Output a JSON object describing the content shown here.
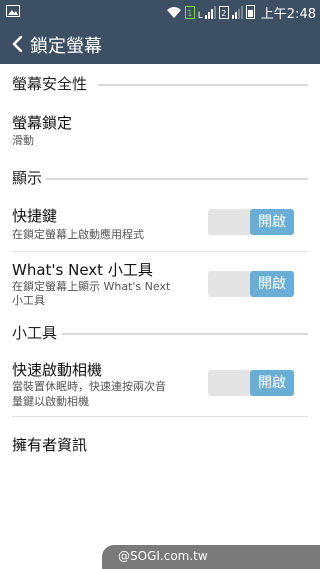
{
  "status_bar": {
    "time": "上午2:48",
    "sim1": "1",
    "sim2": "2",
    "net_type": "L",
    "icons": [
      "image-icon",
      "wifi-icon",
      "signal-icon",
      "battery-icon"
    ]
  },
  "app_bar": {
    "title": "鎖定螢幕",
    "back_icon": "chevron-left-icon"
  },
  "sections": {
    "security": {
      "header": "螢幕安全性",
      "screen_lock": {
        "title": "螢幕鎖定",
        "value": "滑動"
      }
    },
    "display": {
      "header": "顯示",
      "shortcut": {
        "title": "快捷鍵",
        "subtitle": "在鎖定螢幕上啟動應用程式",
        "toggle": "開啟"
      },
      "whats_next": {
        "title": "What's Next 小工具",
        "subtitle_line1": "在鎖定螢幕上顯示 What's Next",
        "subtitle_line2": "小工具",
        "toggle": "開啟"
      }
    },
    "widgets": {
      "header": "小工具",
      "quick_camera": {
        "title": "快速啟動相機",
        "subtitle_line1": "當裝置休眠時，快速連按兩次音",
        "subtitle_line2": "量鍵以啟動相機",
        "toggle": "開啟"
      }
    },
    "owner_info": {
      "title": "擁有者資訊"
    }
  },
  "watermark": {
    "text": "@SOGI.com.tw"
  },
  "colors": {
    "bar_bg": "#3d4f62",
    "toggle_on": "#6aaed6",
    "toggle_off": "#e4e4e4",
    "watermark_bg": "#7a7a7a"
  }
}
